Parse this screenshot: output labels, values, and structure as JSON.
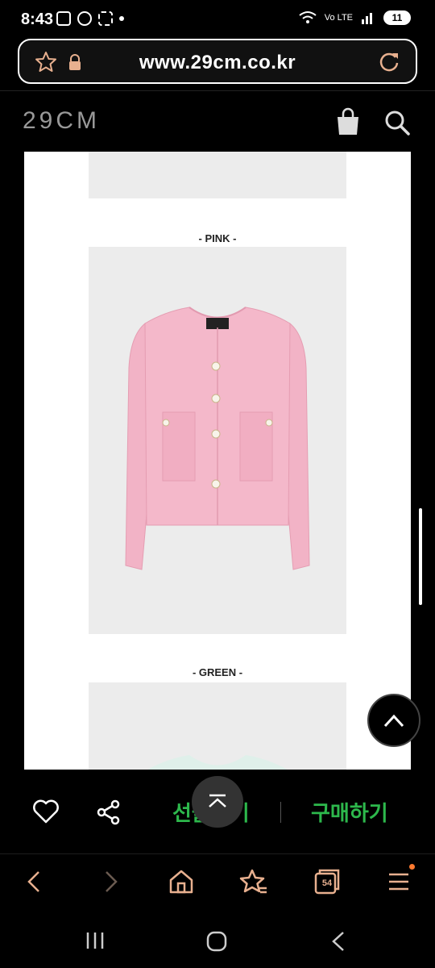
{
  "status": {
    "time": "8:43",
    "battery": "11",
    "network": "Vo LTE"
  },
  "browser": {
    "url": "www.29cm.co.kr",
    "tabs_count": "54"
  },
  "site": {
    "logo": "29CM"
  },
  "product": {
    "colors": [
      {
        "label": "- PINK -",
        "swatch": "#f2b3c6"
      },
      {
        "label": "- GREEN -",
        "swatch": "#dff0ea"
      }
    ]
  },
  "actions": {
    "gift_label": "선물하기",
    "buy_label": "구매하기"
  },
  "colors": {
    "accent_green": "#2db84c",
    "browser_icon": "#e8b08f",
    "notification": "#ff7a30"
  }
}
